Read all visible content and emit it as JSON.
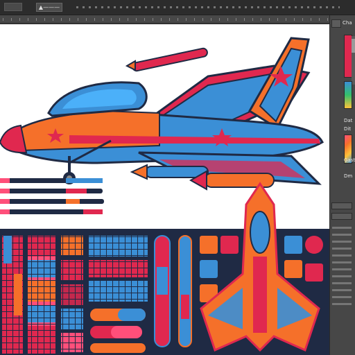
{
  "toolbar": {
    "mode_label": "▲———"
  },
  "panel": {
    "header_label": "Cha",
    "labels": [
      "Dat",
      "Dit",
      "Gaste",
      "Dm"
    ]
  },
  "palette": {
    "navy": "#1f2a44",
    "blue": "#3b8fd6",
    "orange": "#f5702a",
    "red": "#e0284f",
    "pink": "#ff4f7a",
    "yellow": "#ffc23a"
  }
}
